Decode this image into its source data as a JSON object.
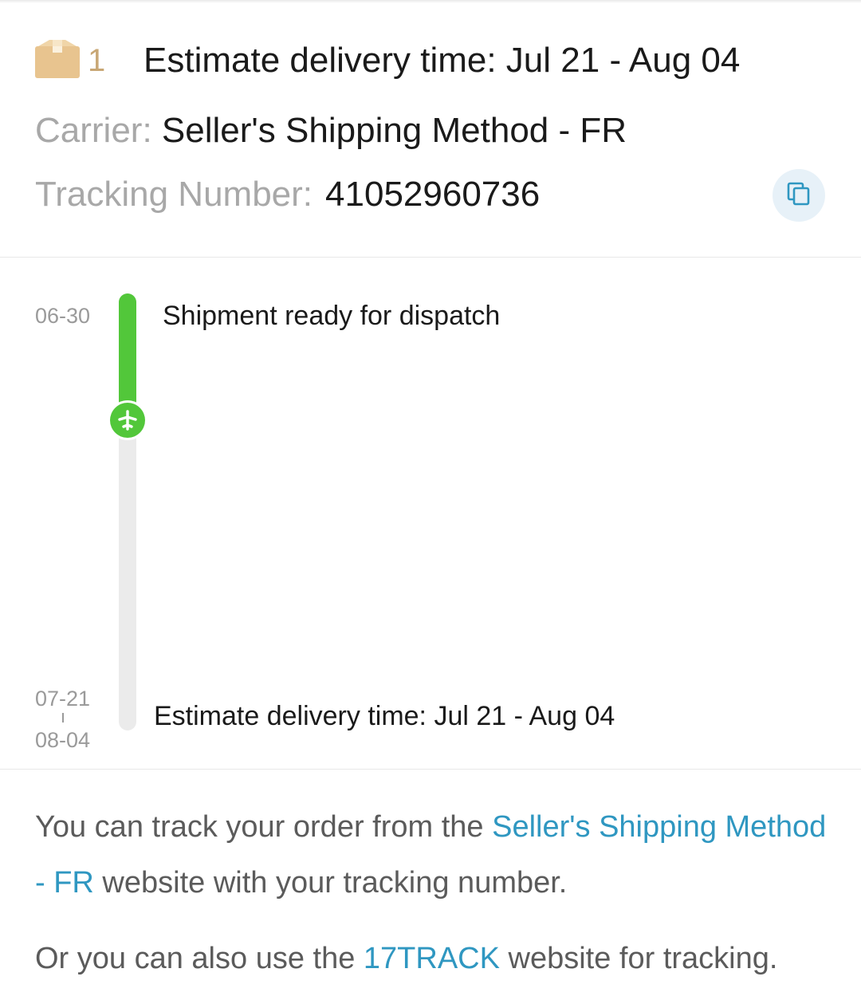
{
  "header": {
    "package_count": "1",
    "estimate_title": "Estimate delivery time: Jul 21 - Aug 04",
    "carrier_label": "Carrier:",
    "carrier_value": " Seller's Shipping Method - FR",
    "tracking_label": "Tracking Number:",
    "tracking_value": "41052960736",
    "copy_icon": "copy-icon",
    "package_icon": "package-box-icon"
  },
  "timeline": {
    "progress_fraction": 0.29,
    "events": [
      {
        "date": "06-30",
        "text": "Shipment ready for dispatch"
      },
      {
        "date_start": "07-21",
        "date_end": "08-04",
        "text": "Estimate delivery time: Jul 21 - Aug 04"
      }
    ],
    "marker_icon": "airplane-icon",
    "colors": {
      "progress": "#52c73a",
      "track": "#ebebeb"
    }
  },
  "footer": {
    "para1_prefix": "You can track your order from the ",
    "para1_link": "Seller's Shipping Method - FR",
    "para1_suffix": " website with your tracking number.",
    "para2_prefix": "Or you can also use the ",
    "para2_link": "17TRACK",
    "para2_suffix": " website for tracking."
  },
  "colors": {
    "link": "#2f97c1",
    "muted": "#a8a8a8",
    "package": "#e8c48f"
  }
}
